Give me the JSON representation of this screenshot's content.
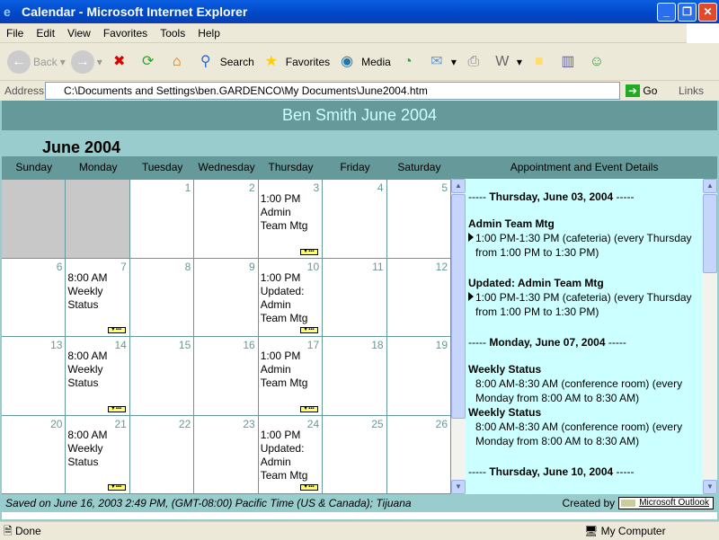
{
  "window": {
    "title": "Calendar - Microsoft Internet Explorer"
  },
  "menu": [
    "File",
    "Edit",
    "View",
    "Favorites",
    "Tools",
    "Help"
  ],
  "toolbar": {
    "back": "Back",
    "search": "Search",
    "favorites": "Favorites",
    "media": "Media"
  },
  "address": {
    "label": "Address",
    "url": "C:\\Documents and Settings\\ben.GARDENCO\\My Documents\\June2004.htm",
    "go": "Go",
    "links": "Links"
  },
  "page": {
    "title": "Ben Smith June 2004",
    "month": "June 2004",
    "weekdays": [
      "Sunday",
      "Monday",
      "Tuesday",
      "Wednesday",
      "Thursday",
      "Friday",
      "Saturday"
    ],
    "details_header": "Appointment and Event Details",
    "weeks": [
      [
        {
          "n": ""
        },
        {
          "n": ""
        },
        {
          "n": "1"
        },
        {
          "n": "2"
        },
        {
          "n": "3",
          "t": "1:00 PM Admin Team Mtg",
          "more": true
        },
        {
          "n": "4"
        },
        {
          "n": "5"
        }
      ],
      [
        {
          "n": "6"
        },
        {
          "n": "7",
          "t": "8:00 AM Weekly Status",
          "more": true
        },
        {
          "n": "8"
        },
        {
          "n": "9"
        },
        {
          "n": "10",
          "t": "1:00 PM Updated: Admin Team Mtg",
          "more": true
        },
        {
          "n": "11"
        },
        {
          "n": "12"
        }
      ],
      [
        {
          "n": "13"
        },
        {
          "n": "14",
          "t": "8:00 AM Weekly Status",
          "more": true
        },
        {
          "n": "15"
        },
        {
          "n": "16"
        },
        {
          "n": "17",
          "t": "1:00 PM Admin Team Mtg",
          "more": true
        },
        {
          "n": "18"
        },
        {
          "n": "19"
        }
      ],
      [
        {
          "n": "20"
        },
        {
          "n": "21",
          "t": "8:00 AM Weekly Status",
          "more": true
        },
        {
          "n": "22"
        },
        {
          "n": "23"
        },
        {
          "n": "24",
          "t": "1:00 PM Updated: Admin Team Mtg",
          "more": true
        },
        {
          "n": "25"
        },
        {
          "n": "26"
        }
      ]
    ],
    "details": [
      {
        "date": "Thursday, June 03, 2004",
        "events": [
          {
            "title": "Admin Team Mtg",
            "line1": "1:00 PM-1:30 PM (cafeteria) (every Thursday",
            "line2": "from 1:00 PM to 1:30 PM)",
            "arrow": true
          },
          {
            "title": "Updated: Admin Team Mtg",
            "line1": "1:00 PM-1:30 PM (cafeteria) (every Thursday",
            "line2": "from 1:00 PM to 1:30 PM)",
            "arrow": true
          }
        ]
      },
      {
        "date": "Monday, June 07, 2004",
        "events": [
          {
            "title": "Weekly Status",
            "line1": "8:00 AM-8:30 AM (conference room) (every",
            "line2": "Monday from 8:00 AM to 8:30 AM)",
            "arrow": false
          },
          {
            "title": "Weekly Status",
            "line1": "8:00 AM-8:30 AM (conference room) (every",
            "line2": "Monday from 8:00 AM to 8:30 AM)",
            "arrow": false
          }
        ]
      },
      {
        "date": "Thursday, June 10, 2004",
        "events": []
      }
    ],
    "footer": {
      "saved": "Saved on June 16, 2003 2:49 PM, (GMT-08:00) Pacific Time (US & Canada); Tijuana",
      "created_by": "Created by",
      "outlook": "Microsoft Outlook"
    }
  },
  "status": {
    "text": "Done",
    "zone": "My Computer"
  },
  "colors": {
    "teal": "#669999",
    "light_teal": "#99cccc",
    "details_bg": "#ccffff",
    "title_text": "#ccffff"
  }
}
